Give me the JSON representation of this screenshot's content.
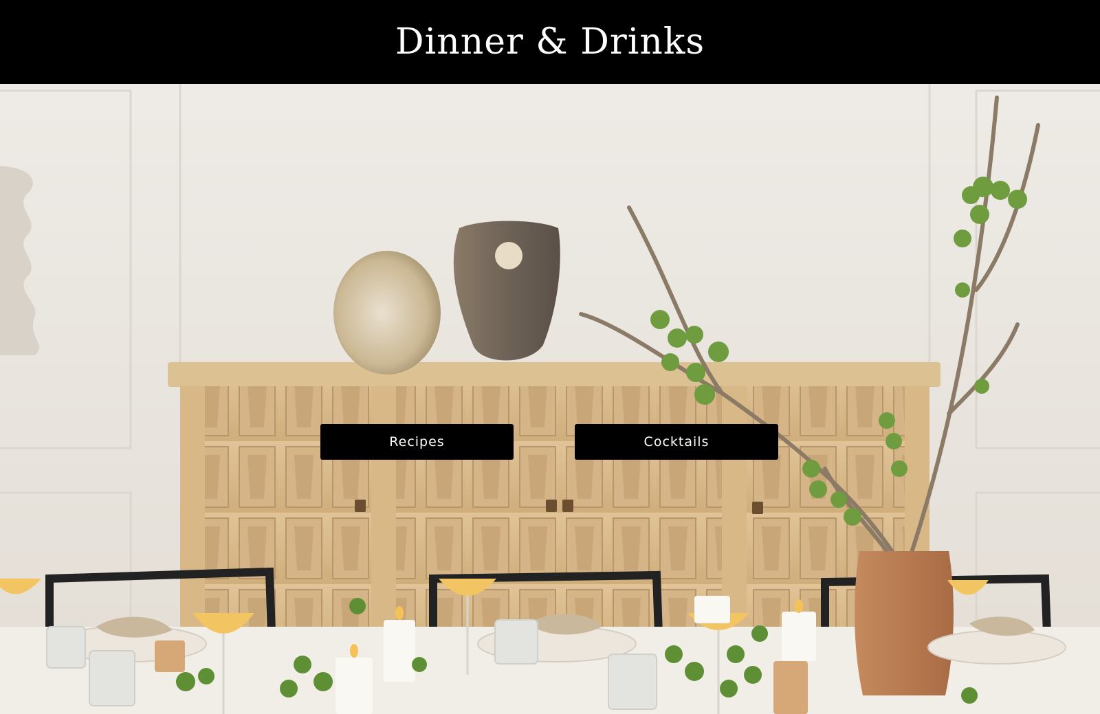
{
  "header": {
    "title": "Dinner & Drinks"
  },
  "hero": {
    "image": "dining-room-sideboard-photo",
    "buttons": [
      {
        "label": "Recipes"
      },
      {
        "label": "Cocktails"
      }
    ]
  },
  "colors": {
    "header_bg": "#000000",
    "button_bg": "#000000",
    "button_text": "#ffffff",
    "wall": "#ebe7e1",
    "wood": "#d9b98a"
  }
}
